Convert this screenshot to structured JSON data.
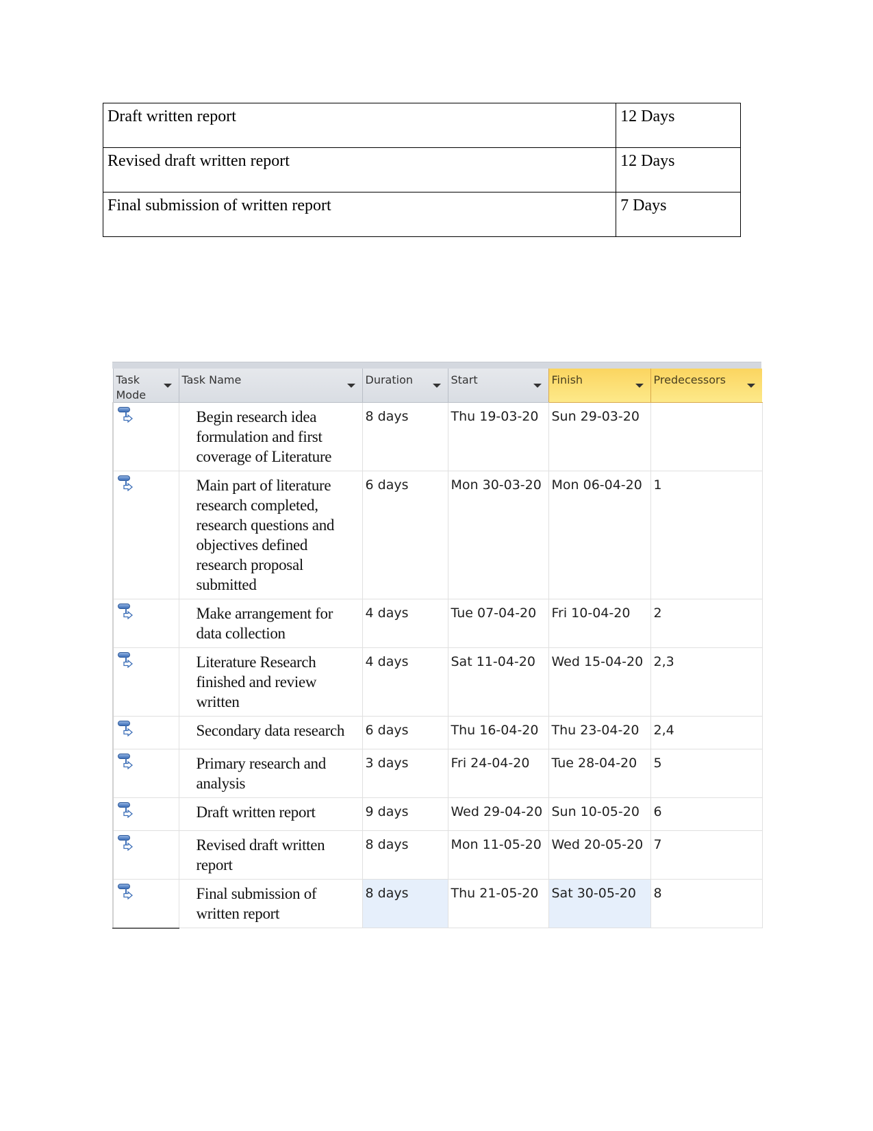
{
  "summary_table": {
    "rows": [
      {
        "task": "Draft written report",
        "duration": "12 Days"
      },
      {
        "task": "Revised draft written report",
        "duration": "12 Days"
      },
      {
        "task": "Final submission of written report",
        "duration": "7 Days"
      }
    ]
  },
  "project_grid": {
    "headers": {
      "mode": "Task Mode",
      "name": "Task Name",
      "duration": "Duration",
      "start": "Start",
      "finish": "Finish",
      "predecessors": "Predecessors"
    },
    "highlight_color": "#fbd560",
    "selection_color": "#e6effb",
    "mode_icon": "auto-scheduled-task-icon",
    "rows": [
      {
        "name": "Begin research idea formulation and first coverage of Literature",
        "duration": "8 days",
        "start": "Thu 19-03-20",
        "finish": "Sun 29-03-20",
        "predecessors": ""
      },
      {
        "name": "Main part of literature research completed, research questions and objectives defined research proposal submitted",
        "duration": "6 days",
        "start": "Mon 30-03-20",
        "finish": "Mon 06-04-20",
        "predecessors": "1"
      },
      {
        "name": "Make arrangement for data collection",
        "duration": "4 days",
        "start": "Tue 07-04-20",
        "finish": "Fri 10-04-20",
        "predecessors": "2"
      },
      {
        "name": "Literature Research finished and review written",
        "duration": "4 days",
        "start": "Sat 11-04-20",
        "finish": "Wed 15-04-20",
        "predecessors": "2,3"
      },
      {
        "name": "Secondary data research",
        "duration": "6 days",
        "start": "Thu 16-04-20",
        "finish": "Thu 23-04-20",
        "predecessors": "2,4"
      },
      {
        "name": "Primary research and analysis",
        "duration": "3 days",
        "start": "Fri 24-04-20",
        "finish": "Tue 28-04-20",
        "predecessors": "5"
      },
      {
        "name": "Draft written report",
        "duration": "9 days",
        "start": "Wed 29-04-20",
        "finish": "Sun 10-05-20",
        "predecessors": "6"
      },
      {
        "name": "Revised draft written report",
        "duration": "8 days",
        "start": "Mon 11-05-20",
        "finish": "Wed 20-05-20",
        "predecessors": "7"
      },
      {
        "name": "Final submission of written report",
        "duration": "8 days",
        "start": "Thu 21-05-20",
        "finish": "Sat 30-05-20",
        "predecessors": "8",
        "selected": true
      }
    ]
  }
}
